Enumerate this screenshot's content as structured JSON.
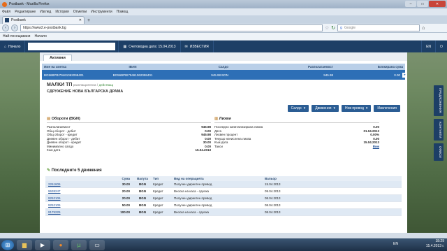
{
  "window": {
    "title": "Postbank - Mozilla Firefox"
  },
  "menu": [
    "Файл",
    "Редактиране",
    "Изглед",
    "История",
    "Отметки",
    "Инструменти",
    "Помощ"
  ],
  "tab": {
    "label": "Postbank",
    "new_tab": "+"
  },
  "nav": {
    "url": "https://www2.e-postbank.bg",
    "search_placeholder": "Google"
  },
  "bookmarks": [
    "Най-посещавани",
    "Начало"
  ],
  "app": {
    "home": "Начало",
    "accounting_date": "Счетоводна дата: 15.04.2013",
    "notices": "ИЗВЕСТИЯ",
    "lang": "EN"
  },
  "tabs": {
    "active": "Активни"
  },
  "accounts_header": [
    "Име на сметка",
    "IBAN",
    "Салдо",
    "Разполагаемост",
    "Блокирана сума"
  ],
  "account_row": {
    "name": "BG56BPBI79461062098401",
    "iban": "BG56BPBI79461062098401",
    "balance": "945.98 BGN",
    "available": "945.98",
    "blocked": "0.00"
  },
  "account": {
    "title": "МАЛКИ ТП",
    "type": "разплащателна",
    "status": "действащ",
    "holder": "СДРУЖЕНИЕ НОВА БЪЛГАРСКА ДРАМА"
  },
  "buttons": {
    "balance": "Салдо",
    "movements": "Движения",
    "new_transfer": "Нов превод",
    "statements": "Извлечения"
  },
  "turnover": {
    "title": "Обороти (BGN)",
    "rows": [
      {
        "label": "Разполагаемост",
        "value": "945.98"
      },
      {
        "label": "Общ оборот - дебит",
        "value": "0.00"
      },
      {
        "label": "Общ оборот - кредит",
        "value": "945.98"
      },
      {
        "label": "Дневен оборот - дебит",
        "value": "0.00"
      },
      {
        "label": "Дневен оборот - кредит",
        "value": "30.00"
      },
      {
        "label": "Минимално салдо",
        "value": "0.00"
      },
      {
        "label": "Към дата",
        "value": "15.04.2013"
      }
    ]
  },
  "interest": {
    "title": "Лихви",
    "rows": [
      {
        "label": "Последно капитализирана лихва",
        "value": "0.00"
      },
      {
        "label": "Дата",
        "value": "01.04.2013"
      },
      {
        "label": "Лихвен процент",
        "value": "0.00%"
      },
      {
        "label": "Текущо начислена лихва",
        "value": "0.00"
      },
      {
        "label": "Към дата",
        "value": "15.04.2013"
      },
      {
        "label": "Такси",
        "value": "Виж"
      }
    ]
  },
  "movements": {
    "title": "Последните 5 движения",
    "headers": [
      "",
      "Сума",
      "Валута",
      "Тип",
      "Вид на операцията",
      "Вальор"
    ],
    "rows": [
      {
        "ref": "2261606",
        "amount": "30.00",
        "currency": "BGN",
        "type": "Кредит",
        "op": "Получен директен превод",
        "date": "15.04.2013"
      },
      {
        "ref": "9638247",
        "amount": "20.00",
        "currency": "BGN",
        "type": "Кредит",
        "op": "Вноска на каса - сделка",
        "date": "09.04.2013"
      },
      {
        "ref": "9252106",
        "amount": "20.00",
        "currency": "BGN",
        "type": "Кредит",
        "op": "Получен директен превод",
        "date": "08.04.2013"
      },
      {
        "ref": "9252105",
        "amount": "50.00",
        "currency": "BGN",
        "type": "Кредит",
        "op": "Получен директен превод",
        "date": "08.04.2013"
      },
      {
        "ref": "9175225",
        "amount": "100.00",
        "currency": "BGN",
        "type": "Кредит",
        "op": "Вноска на каса - сделка",
        "date": "08.04.2013"
      }
    ]
  },
  "sidebar": [
    "ПРЕДЛОЖЕНИЯ",
    "КОНТАКТИ",
    "ОФИСИ"
  ],
  "taskbar": {
    "lang": "EN",
    "time": "18:29",
    "date": "15.4.2013 г."
  }
}
